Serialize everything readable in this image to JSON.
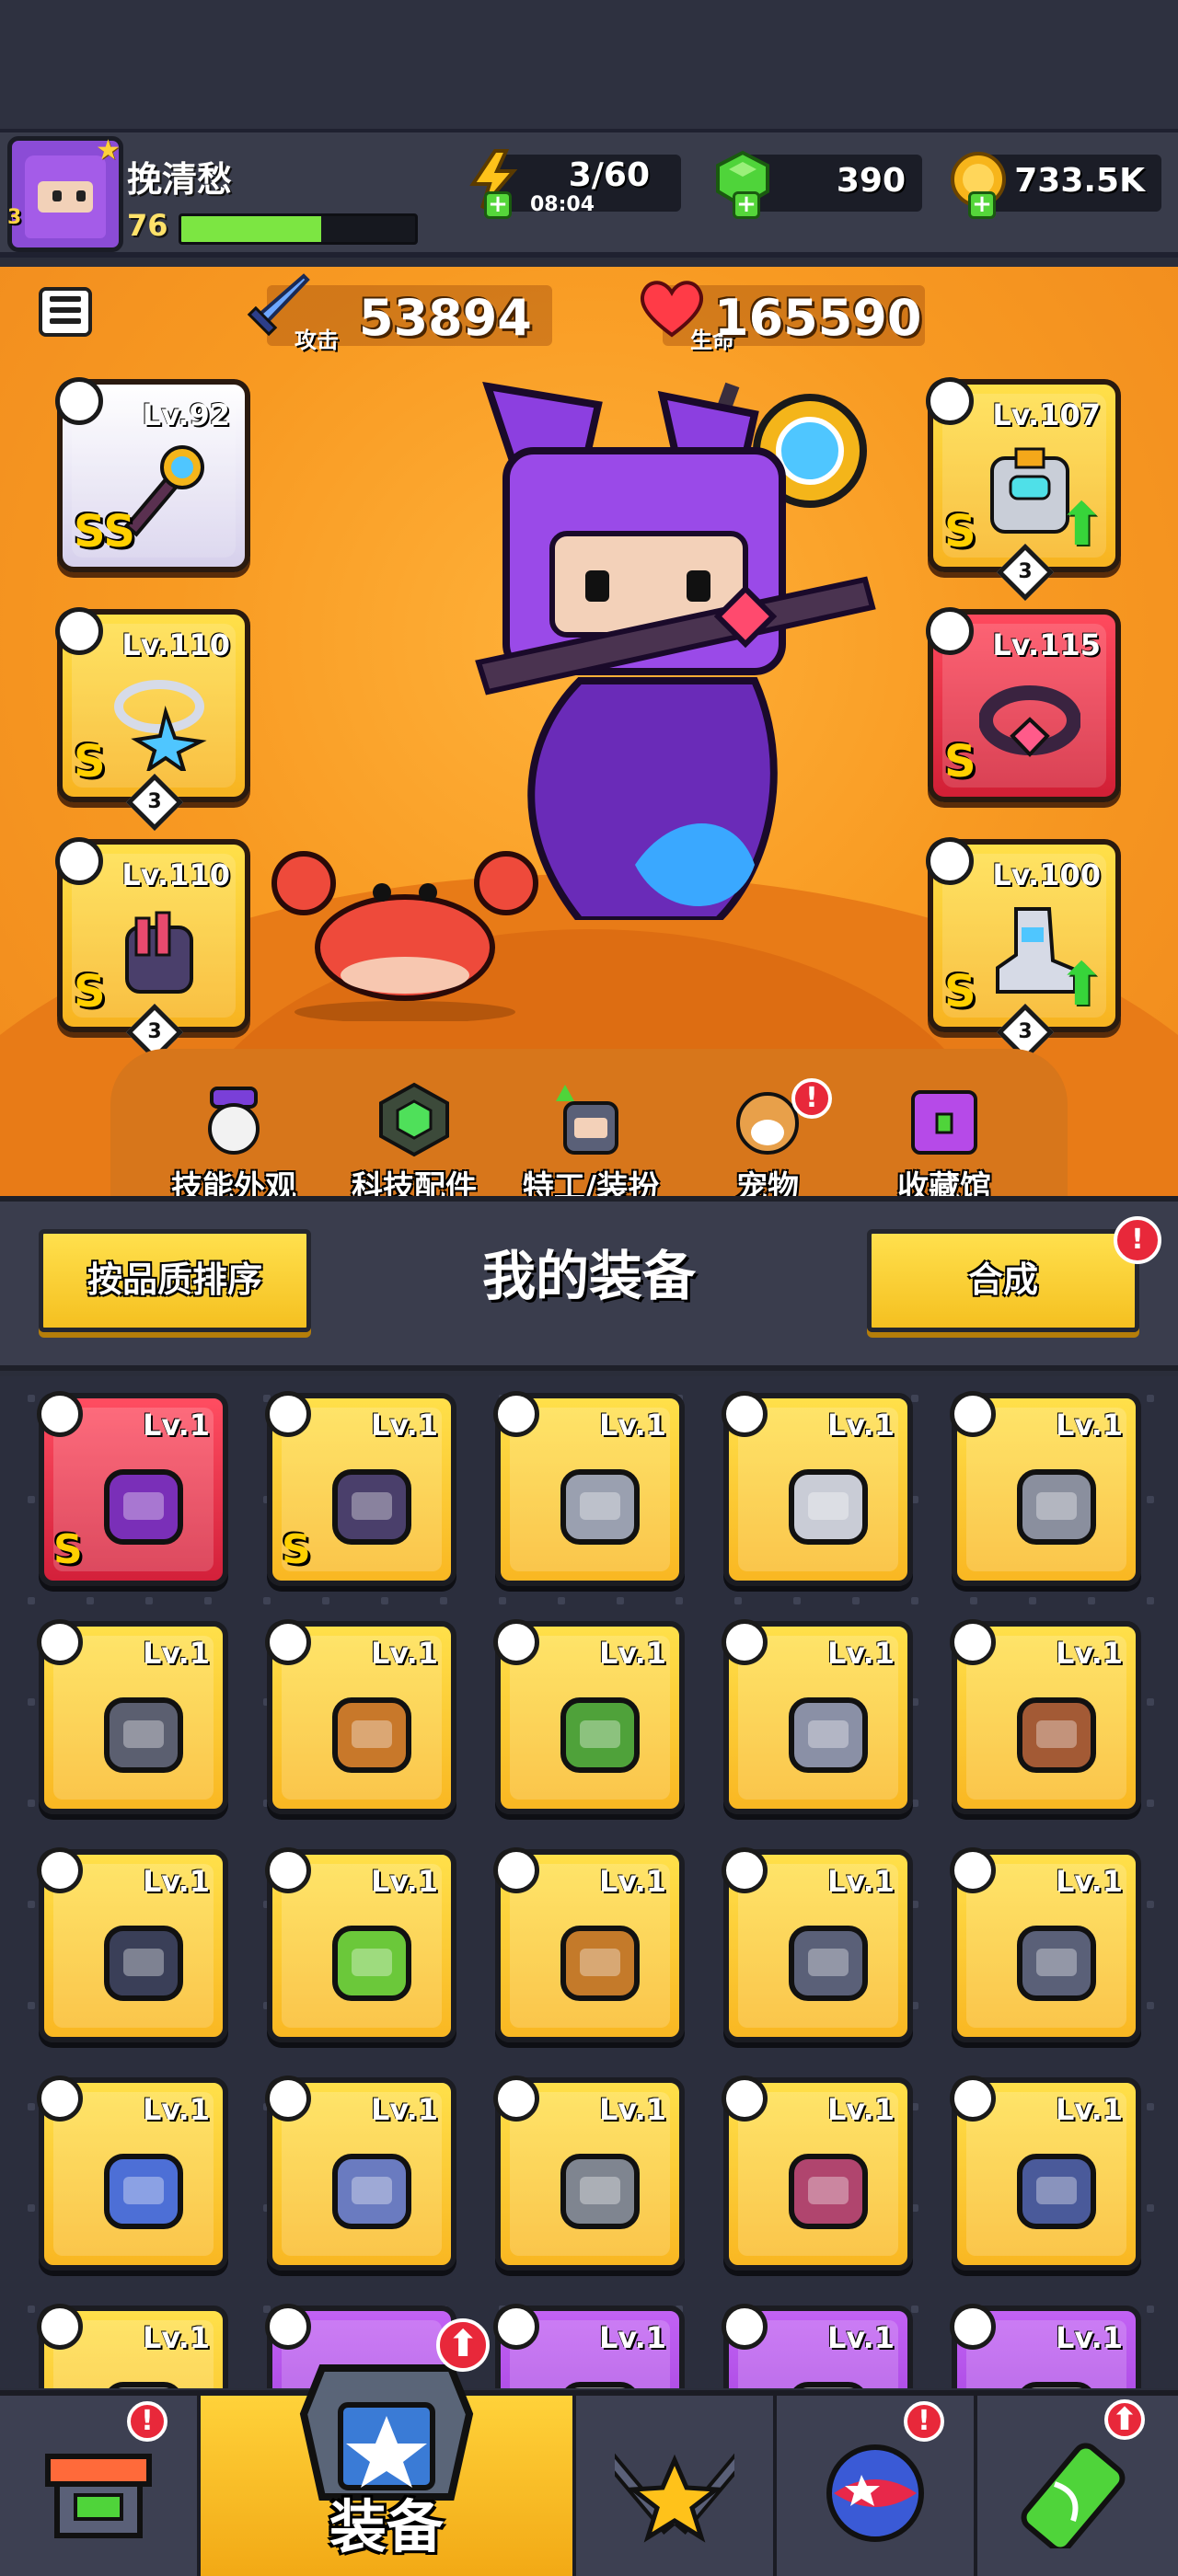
{
  "player": {
    "name": "挽清愁",
    "level": "76",
    "xp_fraction": 0.6,
    "avatar_level": "3"
  },
  "resources": {
    "energy": {
      "value": "3/60",
      "timer": "08:04",
      "icon": "lightning-icon",
      "color": "#ffc21a"
    },
    "gems": {
      "value": "390",
      "icon": "green-gem-icon",
      "color": "#4fd43a"
    },
    "gold": {
      "value": "733.5K",
      "icon": "gold-coin-icon",
      "color": "#f7b51b"
    }
  },
  "stats": {
    "attack": {
      "value": "53894",
      "label": "攻击",
      "icon": "sword-icon"
    },
    "hp": {
      "value": "165590",
      "label": "生命",
      "icon": "heart-icon"
    }
  },
  "equipped": {
    "left": [
      {
        "level": "Lv.92",
        "grade": "SS",
        "frame": "white",
        "type_icon": "weapon-type-icon",
        "item": "staff"
      },
      {
        "level": "Lv.110",
        "grade": "S",
        "frame": "gold",
        "stars": "3",
        "type_icon": "necklace-type-icon",
        "item": "star-necklace"
      },
      {
        "level": "Lv.110",
        "grade": "S",
        "frame": "gold",
        "stars": "3",
        "type_icon": "glove-type-icon",
        "item": "claw-gauntlet"
      }
    ],
    "right": [
      {
        "level": "Lv.107",
        "grade": "S",
        "frame": "gold",
        "stars": "3",
        "type_icon": "armor-type-icon",
        "item": "mech-armor",
        "upgrade": true
      },
      {
        "level": "Lv.115",
        "grade": "S",
        "frame": "red",
        "type_icon": "belt-type-icon",
        "item": "gem-belt"
      },
      {
        "level": "Lv.100",
        "grade": "S",
        "frame": "gold",
        "stars": "3",
        "type_icon": "boots-type-icon",
        "item": "mech-boots",
        "upgrade": true
      }
    ]
  },
  "hero_menu": [
    {
      "label": "技能外观",
      "icon": "skill-skin-icon",
      "alert": false
    },
    {
      "label": "科技配件",
      "icon": "tech-parts-icon",
      "alert": false
    },
    {
      "label": "特工/装扮",
      "icon": "agent-outfit-icon",
      "alert": false
    },
    {
      "label": "宠物",
      "icon": "pet-dog-icon",
      "alert": true
    },
    {
      "label": "收藏馆",
      "icon": "collection-chest-icon",
      "alert": false
    }
  ],
  "inventory": {
    "sort_label": "按品质排序",
    "title": "我的装备",
    "merge_label": "合成",
    "merge_alert": "!",
    "items": [
      {
        "level": "Lv.1",
        "frame": "red",
        "grade": "S",
        "item": "shuriken-dagger",
        "color": "#7a2fb8"
      },
      {
        "level": "Lv.1",
        "frame": "gold",
        "grade": "S",
        "item": "claw-gauntlet",
        "color": "#4a3f6b"
      },
      {
        "level": "Lv.1",
        "frame": "gold",
        "grade": "",
        "item": "kunai",
        "color": "#9aa0b0"
      },
      {
        "level": "Lv.1",
        "frame": "gold",
        "grade": "",
        "item": "katana",
        "color": "#c9ccd6"
      },
      {
        "level": "Lv.1",
        "frame": "gold",
        "grade": "",
        "item": "revolver",
        "color": "#8a8f9e"
      },
      {
        "level": "Lv.1",
        "frame": "gold",
        "grade": "",
        "item": "shotgun",
        "color": "#5b5f70"
      },
      {
        "level": "Lv.1",
        "frame": "gold",
        "grade": "",
        "item": "torch-club",
        "color": "#c8782a"
      },
      {
        "level": "Lv.1",
        "frame": "gold",
        "grade": "",
        "item": "leaf-armor",
        "color": "#4fa23a"
      },
      {
        "level": "Lv.1",
        "frame": "gold",
        "grade": "",
        "item": "steel-armor",
        "color": "#8a90a6"
      },
      {
        "level": "Lv.1",
        "frame": "gold",
        "grade": "",
        "item": "tooth-necklace",
        "color": "#a35a35"
      },
      {
        "level": "Lv.1",
        "frame": "gold",
        "grade": "",
        "item": "spike-collar",
        "color": "#3a3f58"
      },
      {
        "level": "Lv.1",
        "frame": "gold",
        "grade": "",
        "item": "gem-necklace",
        "color": "#6bc83a"
      },
      {
        "level": "Lv.1",
        "frame": "gold",
        "grade": "",
        "item": "rope-belt",
        "color": "#c47a2a"
      },
      {
        "level": "Lv.1",
        "frame": "gold",
        "grade": "",
        "item": "star-belt",
        "color": "#5a6078"
      },
      {
        "level": "Lv.1",
        "frame": "gold",
        "grade": "",
        "item": "star-belt",
        "color": "#5a6078"
      },
      {
        "level": "Lv.1",
        "frame": "gold",
        "grade": "",
        "item": "fur-glove",
        "color": "#4d6fd6"
      },
      {
        "level": "Lv.1",
        "frame": "gold",
        "grade": "",
        "item": "robot-glove",
        "color": "#6a7bc0"
      },
      {
        "level": "Lv.1",
        "frame": "gold",
        "grade": "",
        "item": "mech-glove",
        "color": "#7f8590"
      },
      {
        "level": "Lv.1",
        "frame": "gold",
        "grade": "",
        "item": "spiked-boot",
        "color": "#b0456e"
      },
      {
        "level": "Lv.1",
        "frame": "gold",
        "grade": "",
        "item": "sneaker",
        "color": "#4a5a9a"
      },
      {
        "level": "Lv.1",
        "frame": "gold",
        "grade": "",
        "item": "boot",
        "color": "#888"
      },
      {
        "level": "",
        "frame": "purple",
        "grade": "",
        "item": "hidden-weapon",
        "color": "#888"
      },
      {
        "level": "Lv.1",
        "frame": "purple",
        "grade": "",
        "item": "weapon",
        "color": "#888"
      },
      {
        "level": "Lv.1",
        "frame": "purple",
        "grade": "",
        "item": "weapon",
        "color": "#888"
      },
      {
        "level": "Lv.1",
        "frame": "purple",
        "grade": "",
        "item": "armor",
        "color": "#888"
      }
    ]
  },
  "bottom_nav": [
    {
      "label": "",
      "icon": "shop-icon",
      "alert": true
    },
    {
      "label": "装备",
      "icon": "equipment-icon",
      "alert": true,
      "active": true
    },
    {
      "label": "",
      "icon": "battle-swords-star-icon",
      "alert": false
    },
    {
      "label": "",
      "icon": "planet-icon",
      "alert": true
    },
    {
      "label": "",
      "icon": "dna-tube-icon",
      "alert": true
    }
  ]
}
